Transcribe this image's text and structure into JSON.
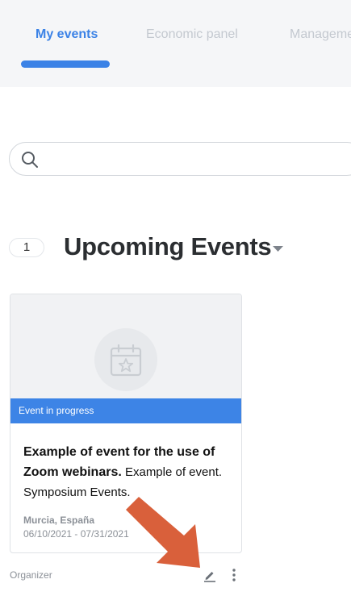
{
  "tabs": [
    {
      "label": "My events",
      "active": true
    },
    {
      "label": "Economic panel",
      "active": false
    },
    {
      "label": "Management",
      "active": false
    }
  ],
  "search": {
    "placeholder": "",
    "value": "",
    "icon": "search-icon"
  },
  "section": {
    "count": "1",
    "title": "Upcoming Events",
    "caret_icon": "caret-down-icon"
  },
  "event": {
    "status": "Event in progress",
    "name": "Example of event for the use of Zoom webinars.",
    "description": "Example of event. Symposium Events.",
    "location": "Murcia, España",
    "dates": "06/10/2021 - 07/31/2021",
    "placeholder_icon": "calendar-star-icon"
  },
  "footer": {
    "role": "Organizer",
    "edit_icon": "pencil-icon",
    "more_icon": "more-vertical-icon"
  },
  "colors": {
    "accent": "#3b82e6",
    "status_band": "#3d84e6",
    "annotation_arrow": "#d9603b"
  }
}
